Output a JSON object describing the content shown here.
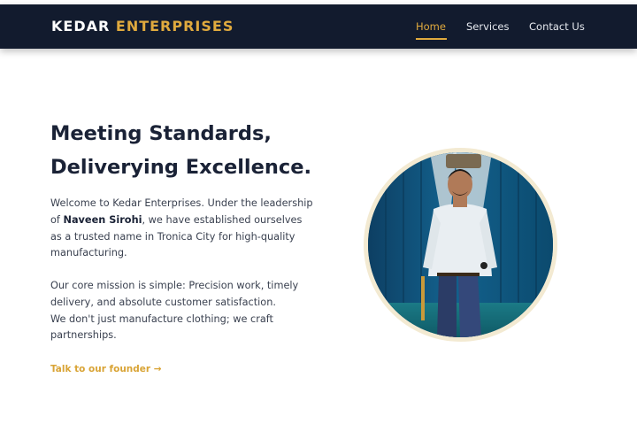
{
  "brand": {
    "name_first": "KEDAR",
    "name_second": "ENTERPRISES"
  },
  "nav": {
    "items": [
      "Home",
      "Services",
      "Contact Us"
    ],
    "active": "Home"
  },
  "hero": {
    "title_line1": "Meeting Standards,",
    "title_line2": "Deliverying Excellence.",
    "para1_before": "Welcome to Kedar Enterprises. Under the leadership of ",
    "para1_name": "Naveen Sirohi",
    "para1_after": ", we have established ourselves as a trusted name in Tronica City for high-quality manufacturing.",
    "para2_line1": "Our core mission is simple: Precision work, timely delivery, and absolute customer satisfaction.",
    "para2_line2": "We don't just manufacture clothing; we craft partnerships.",
    "cta": "Talk to our founder →"
  },
  "colors": {
    "navbar": "#121b2e",
    "accent": "#e0aa3e",
    "ring": "#f3ead2",
    "photo_backdrop": "#0f4d74"
  },
  "photo": {
    "alt": "founder-portrait"
  }
}
